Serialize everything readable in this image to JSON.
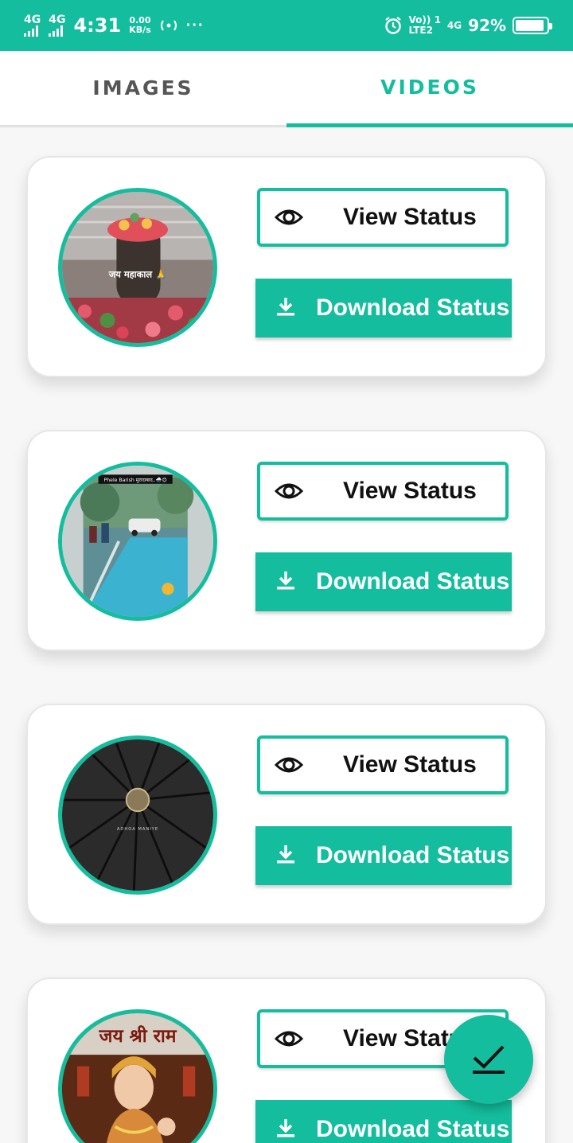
{
  "status_bar": {
    "network_1": "4G",
    "network_2": "4G",
    "time": "4:31",
    "speed_value": "0.00",
    "speed_unit": "KB/s",
    "more": "···",
    "volte_top": "Vo)) 1",
    "volte_bottom": "LTE2",
    "network_3": "4G",
    "battery_percent": "92%",
    "battery_level": 0.92
  },
  "tabs": {
    "images_label": "IMAGES",
    "videos_label": "VIDEOS",
    "active": "VIDEOS"
  },
  "statuses": [
    {
      "thumbnail_caption": "जय महाकाल 🙏",
      "view_label": "View Status",
      "download_label": "Download Status"
    },
    {
      "thumbnail_caption": "Phele Barish मुरादाबाद..🌧️😊",
      "view_label": "View Status",
      "download_label": "Download Status"
    },
    {
      "thumbnail_caption": "ADHOA MANIYE",
      "view_label": "View Status",
      "download_label": "Download Status"
    },
    {
      "thumbnail_caption": "जय श्री राम",
      "view_label": "View Status",
      "download_label": "Download Status"
    }
  ],
  "colors": {
    "accent": "#14bd9d",
    "text_dark": "#111111",
    "tab_inactive": "#555555"
  },
  "icons": {
    "view": "eye-icon",
    "download": "download-icon",
    "fab": "check-icon"
  }
}
